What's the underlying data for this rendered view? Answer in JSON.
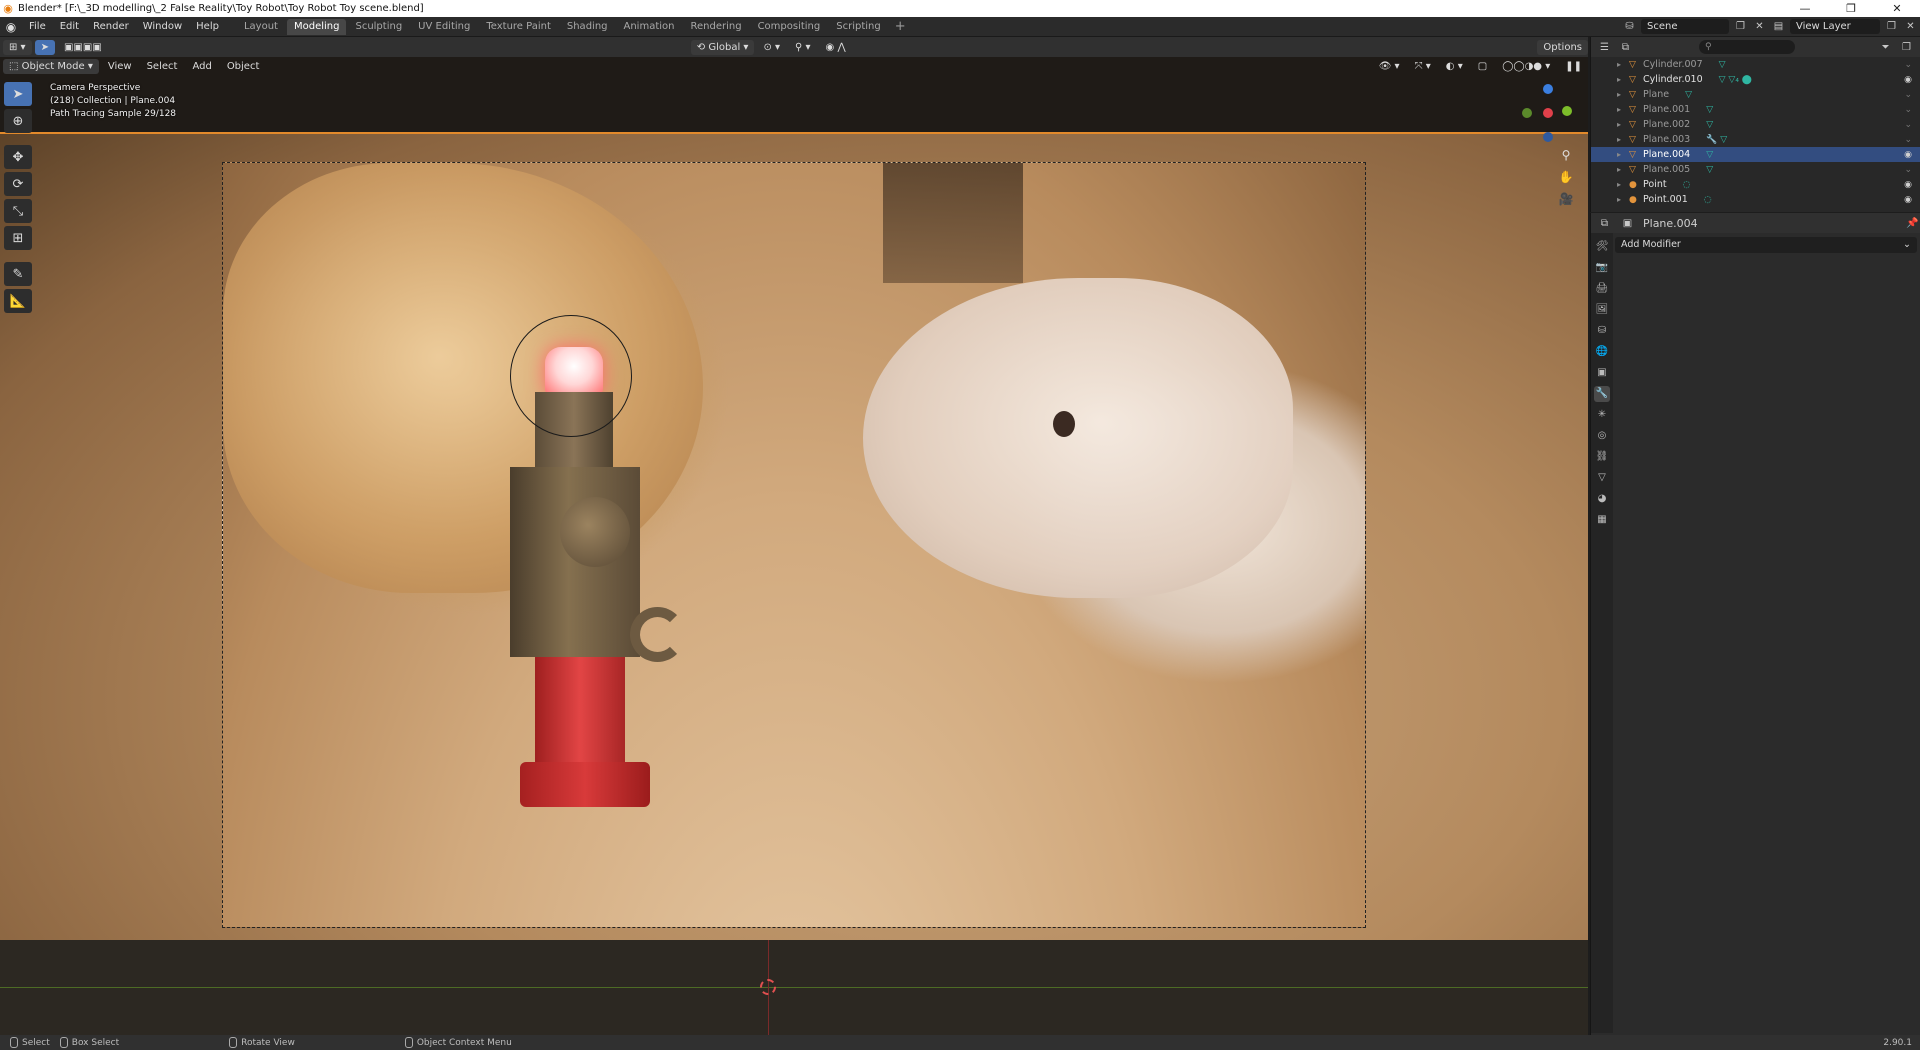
{
  "window": {
    "title": "Blender* [F:\\_3D modelling\\_2 False Reality\\Toy Robot\\Toy Robot Toy scene.blend]",
    "controls": {
      "minimize": "—",
      "maximize": "❐",
      "close": "✕"
    }
  },
  "menu": [
    "File",
    "Edit",
    "Render",
    "Window",
    "Help"
  ],
  "workspaces": {
    "tabs": [
      "Layout",
      "Modeling",
      "Sculpting",
      "UV Editing",
      "Texture Paint",
      "Shading",
      "Animation",
      "Rendering",
      "Compositing",
      "Scripting"
    ],
    "active": "Modeling",
    "add": "+"
  },
  "scene": {
    "name": "Scene",
    "view_layer": "View Layer"
  },
  "tool_header": {
    "orientation": "Global",
    "options": "Options"
  },
  "viewport_header": {
    "mode": "Object Mode",
    "menus": [
      "View",
      "Select",
      "Add",
      "Object"
    ]
  },
  "viewport_overlay": {
    "line1": "Camera Perspective",
    "line2": "(218) Collection | Plane.004",
    "line3": "Path Tracing Sample 29/128"
  },
  "outliner": {
    "search_placeholder": "",
    "rows": [
      {
        "name": "Cylinder.007",
        "state": "dim"
      },
      {
        "name": "Cylinder.010",
        "state": "bright"
      },
      {
        "name": "Plane",
        "state": "dim"
      },
      {
        "name": "Plane.001",
        "state": "dim"
      },
      {
        "name": "Plane.002",
        "state": "dim"
      },
      {
        "name": "Plane.003",
        "state": "dim"
      },
      {
        "name": "Plane.004",
        "state": "selected"
      },
      {
        "name": "Plane.005",
        "state": "dim"
      },
      {
        "name": "Point",
        "state": "bright"
      },
      {
        "name": "Point.001",
        "state": "bright"
      }
    ]
  },
  "properties": {
    "object_name": "Plane.004",
    "add_modifier": "Add Modifier"
  },
  "statusbar": {
    "select": "Select",
    "box_select": "Box Select",
    "rotate_view": "Rotate View",
    "context_menu": "Object Context Menu",
    "version": "2.90.1"
  },
  "colors": {
    "accent_blue": "#4772b3",
    "selection_orange": "#e38a2b",
    "outliner_selected": "#334d80"
  }
}
